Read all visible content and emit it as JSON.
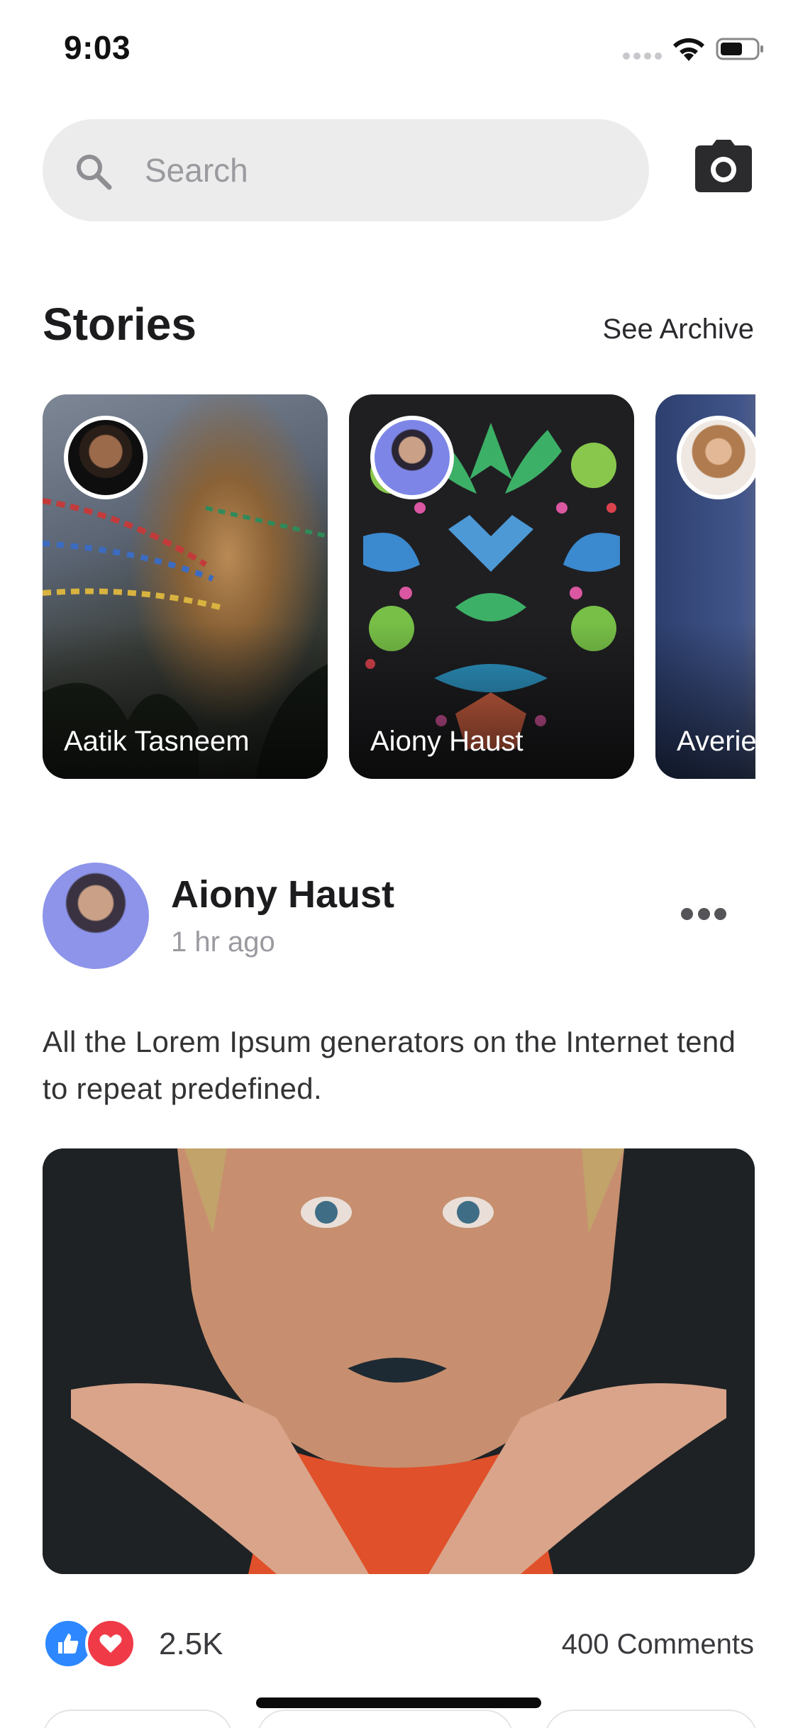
{
  "status_bar": {
    "time": "9:03"
  },
  "search": {
    "placeholder": "Search"
  },
  "stories": {
    "title": "Stories",
    "see_archive": "See Archive",
    "items": [
      {
        "name": "Aatik Tasneem"
      },
      {
        "name": "Aiony Haust"
      },
      {
        "name": "Averie"
      }
    ]
  },
  "post": {
    "author": "Aiony Haust",
    "time": "1 hr ago",
    "text": "All the Lorem Ipsum generators on the Internet tend to repeat predefined.",
    "reaction_count": "2.5K",
    "comments": "400 Comments"
  },
  "colors": {
    "like": "#2d88ff",
    "love": "#f03a47",
    "search_bg": "#ececec"
  },
  "icons": [
    "search-icon",
    "camera-icon",
    "more-icon",
    "like-icon",
    "heart-icon",
    "wifi-icon",
    "battery-icon"
  ]
}
